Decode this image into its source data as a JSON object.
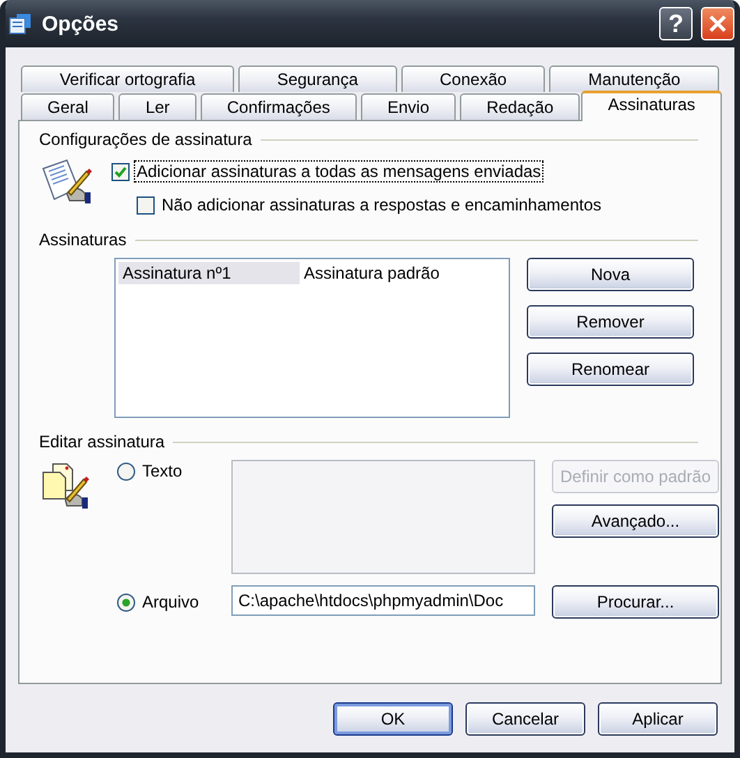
{
  "window": {
    "title": "Opções",
    "help_button": "?"
  },
  "tab_rows": [
    [
      {
        "label": "Verificar ortografia",
        "selected": false
      },
      {
        "label": "Segurança",
        "selected": false
      },
      {
        "label": "Conexão",
        "selected": false
      },
      {
        "label": "Manutenção",
        "selected": false
      }
    ],
    [
      {
        "label": "Geral",
        "selected": false
      },
      {
        "label": "Ler",
        "selected": false
      },
      {
        "label": "Confirmações",
        "selected": false
      },
      {
        "label": "Envio",
        "selected": false
      },
      {
        "label": "Redação",
        "selected": false
      },
      {
        "label": "Assinaturas",
        "selected": true
      }
    ]
  ],
  "signature_settings": {
    "heading": "Configurações de assinatura",
    "options": [
      {
        "label": "Adicionar assinaturas a todas as mensagens enviadas",
        "checked": true,
        "focused": true
      },
      {
        "label": "Não adicionar assinaturas a respostas e encaminhamentos",
        "checked": false,
        "focused": false
      }
    ]
  },
  "signatures": {
    "heading": "Assinaturas",
    "list": [
      {
        "name": "Assinatura nº1",
        "note": "Assinatura padrão",
        "selected": true
      }
    ],
    "buttons": [
      {
        "label": "Nova",
        "disabled": false
      },
      {
        "label": "Remover",
        "disabled": false
      },
      {
        "label": "Renomear",
        "disabled": false
      }
    ]
  },
  "edit_signature": {
    "heading": "Editar assinatura",
    "sources": [
      {
        "kind": "text",
        "label": "Texto",
        "selected": false
      },
      {
        "kind": "file",
        "label": "Arquivo",
        "selected": true
      }
    ],
    "file_path": "C:\\apache\\htdocs\\phpmyadmin\\Doc",
    "buttons": [
      {
        "label": "Definir como padrão",
        "disabled": true
      },
      {
        "label": "Avançado...",
        "disabled": false
      },
      {
        "label": "Procurar...",
        "disabled": false
      }
    ]
  },
  "footer_buttons": [
    {
      "label": "OK",
      "default": true
    },
    {
      "label": "Cancelar",
      "default": false
    },
    {
      "label": "Aplicar",
      "default": false
    }
  ]
}
